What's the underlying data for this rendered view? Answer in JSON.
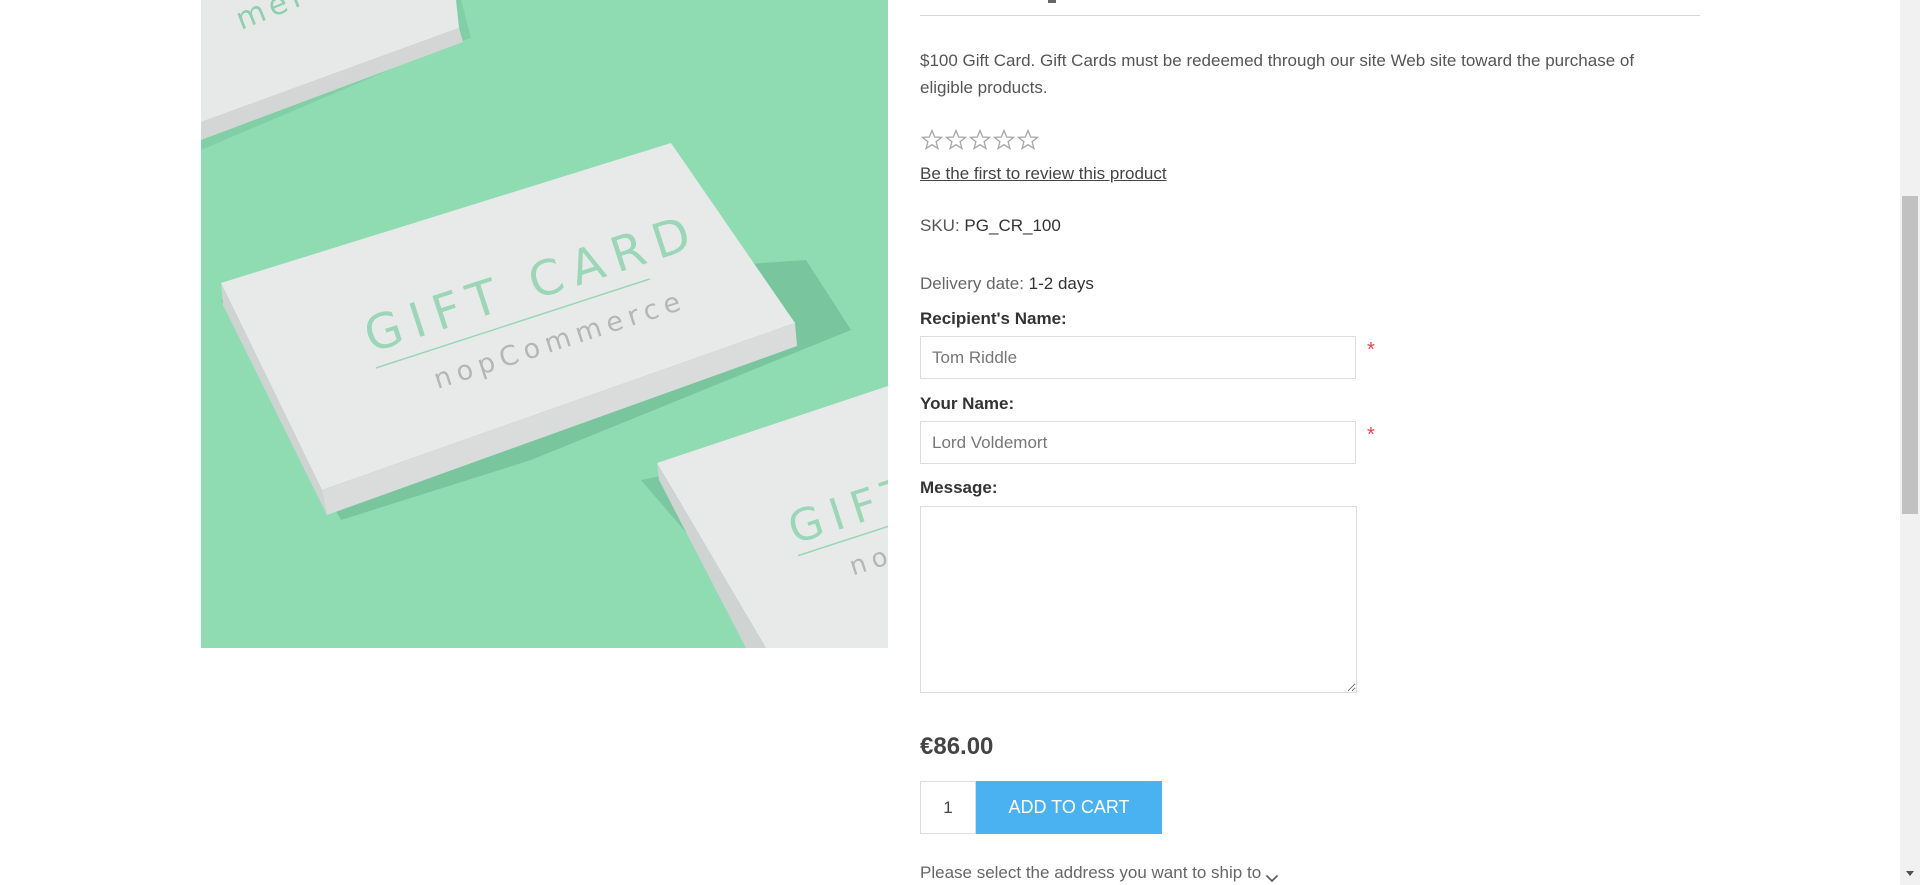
{
  "product": {
    "image_brand_text": "GIFT CARD",
    "image_sub_text": "nopCommerce",
    "image_partial_top": "merce",
    "image_partial_right_1": "GIFT",
    "image_partial_right_2": "nop",
    "description": "$100 Gift Card. Gift Cards must be redeemed through our site Web site toward the purchase of eligible products.",
    "rating_stars": 5,
    "rating_value": 0,
    "review_link": "Be the first to review this product",
    "sku_label": "SKU:",
    "sku_value": "PG_CR_100",
    "delivery_label": "Delivery date:",
    "delivery_value": "1-2 days",
    "price": "€86.00",
    "quantity": "1",
    "add_to_cart_label": "ADD TO CART",
    "ship_to_label": "Please select the address you want to ship to"
  },
  "form": {
    "recipient_label": "Recipient's Name:",
    "recipient_placeholder": "Tom Riddle",
    "your_name_label": "Your Name:",
    "your_name_placeholder": "Lord Voldemort",
    "message_label": "Message:",
    "required_marker": "*"
  },
  "colors": {
    "accent": "#4ab2f1",
    "required": "#e4434b",
    "image_background": "#8fdcb3"
  },
  "icons": [
    "star-outline-icon",
    "chevron-down-icon",
    "resize-handle-icon"
  ]
}
